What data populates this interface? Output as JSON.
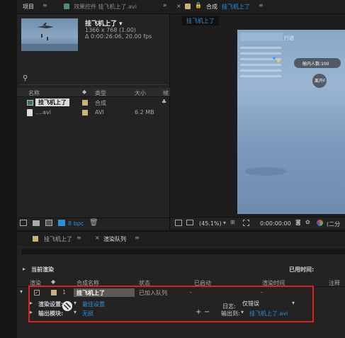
{
  "project_panel": {
    "tab_project": "项目",
    "tab_effects": "效果控件 挂飞机上了.avi",
    "overflow_icon": "double-chevron-icon",
    "comp_name": "挂飞机上了 ▾",
    "comp_size": "1366 x 768 (1.00)",
    "comp_duration": "Δ 0:00:26:06, 20.00 fps",
    "search_placeholder": "",
    "columns": {
      "name": "名称",
      "type": "类型",
      "size": "大小",
      "frame": "帧"
    },
    "items": [
      {
        "name": "挂飞机上了",
        "type": "合成",
        "size": ""
      },
      {
        "name": "....avi",
        "type": "AVI",
        "size": "6.2 MB"
      }
    ],
    "bpc_label": "8 bpc"
  },
  "comp_panel": {
    "tab_label": "合成",
    "comp_title": "挂飞机上了",
    "breadcrumb": "挂飞机上了",
    "zoom": "(45.1%)",
    "timecode": "0:00:00:00",
    "view_mode": "(二分",
    "game_overlay": {
      "stat_label": "行进",
      "people_label": "舱内人数:100",
      "jump_label": "离开F"
    }
  },
  "timeline_tabs": [
    {
      "label": "挂飞机上了"
    },
    {
      "label": "渲染队列"
    }
  ],
  "render_queue": {
    "current_render_label": "当前渲染",
    "elapsed_label": "已用时间:",
    "columns": {
      "render": "渲染",
      "comp_name": "合成名称",
      "status": "状态",
      "started": "已启动",
      "render_time": "渲染时间",
      "comment": "注释"
    },
    "item": {
      "index": "1",
      "comp_name": "挂飞机上了",
      "status": "已加入队列",
      "started": "-",
      "render_time": "-"
    },
    "render_settings_label": "渲染设置:",
    "render_settings_value": "最佳设置",
    "output_module_label": "输出模块:",
    "output_module_value": "无损",
    "log_label": "日志:",
    "log_value": "仅错误",
    "output_to_label": "输出到:",
    "output_to_value": "挂飞机上了.avi"
  },
  "colors": {
    "accent_blue": "#2e8fd6",
    "highlight_red": "#e02020",
    "label_tan": "#c8b27a"
  }
}
